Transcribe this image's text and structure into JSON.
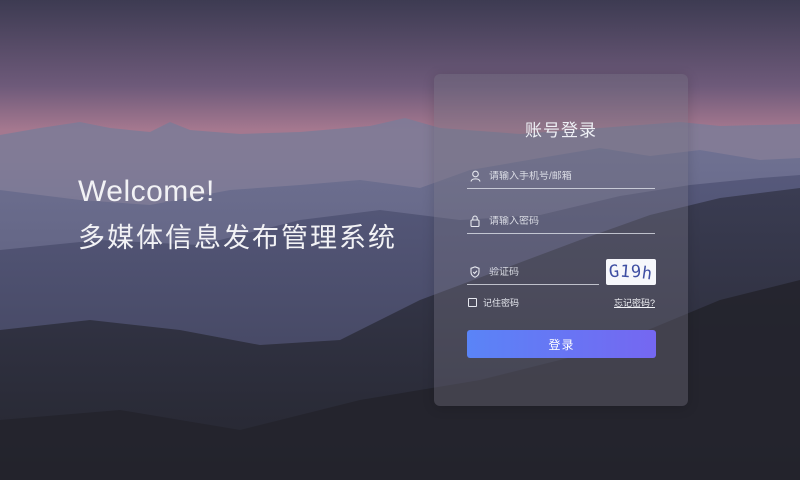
{
  "welcome": {
    "title": "Welcome!",
    "subtitle": "多媒体信息发布管理系统"
  },
  "login": {
    "title": "账号登录",
    "username_placeholder": "请输入手机号/邮箱",
    "password_placeholder": "请输入密码",
    "captcha_placeholder": "验证码",
    "captcha_text": [
      "G",
      "1",
      "9",
      "h"
    ],
    "remember_label": "记住密码",
    "forgot_label": "忘记密码?",
    "submit_label": "登录"
  },
  "icons": {
    "username": "user-icon",
    "password": "lock-icon",
    "captcha": "shield-icon"
  },
  "colors": {
    "button_start": "#5a84f7",
    "button_end": "#7567f1"
  }
}
